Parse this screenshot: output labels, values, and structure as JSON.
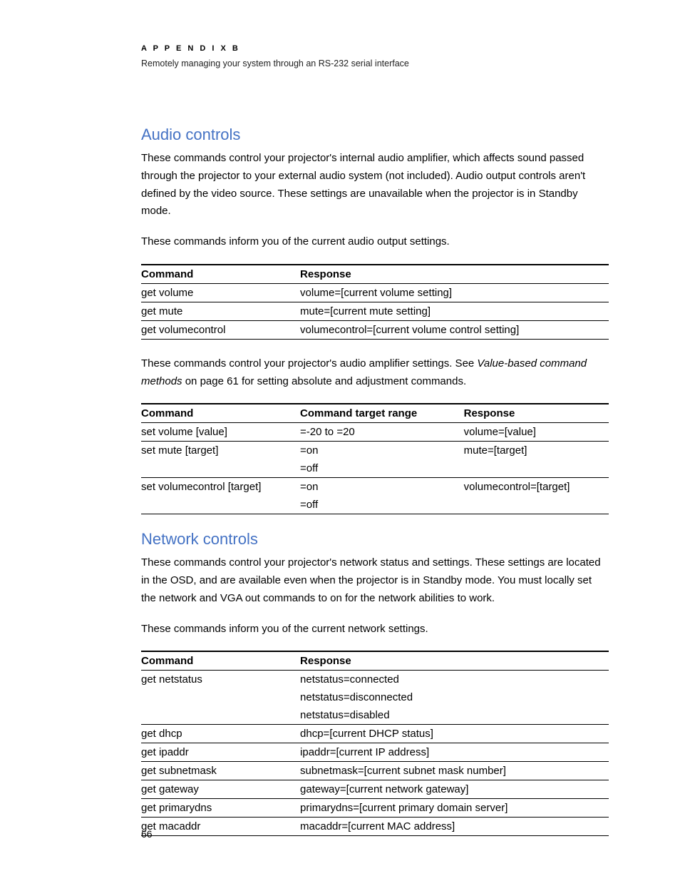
{
  "header": {
    "appendix": "A P P E N D I X   B",
    "subtitle": "Remotely managing your system through an RS-232 serial interface"
  },
  "section1": {
    "heading": "Audio controls",
    "para1": "These commands control your projector's internal audio amplifier, which affects sound passed through the projector to your external audio system (not included). Audio output controls aren't defined by the video source. These settings are unavailable when the projector is in Standby mode.",
    "para2": "These commands inform you of the current audio output settings.",
    "para3a": "These commands control your projector's audio amplifier settings. See ",
    "para3_italic": "Value-based command methods",
    "para3b": " on page 61 for setting absolute and adjustment commands."
  },
  "table1": {
    "h1": "Command",
    "h2": "Response",
    "rows": [
      {
        "c": "get volume",
        "r": "volume=[current volume setting]"
      },
      {
        "c": "get mute",
        "r": "mute=[current mute setting]"
      },
      {
        "c": "get volumecontrol",
        "r": "volumecontrol=[current volume control setting]"
      }
    ]
  },
  "table2": {
    "h1": "Command",
    "h2": "Command target range",
    "h3": "Response",
    "rows": [
      {
        "c": "set volume [value]",
        "t": "=-20 to =20",
        "r": "volume=[value]"
      },
      {
        "c": "set mute [target]",
        "t": "=on",
        "r": "mute=[target]"
      },
      {
        "c": "",
        "t": "=off",
        "r": ""
      },
      {
        "c": "set volumecontrol [target]",
        "t": "=on",
        "r": "volumecontrol=[target]"
      },
      {
        "c": "",
        "t": "=off",
        "r": ""
      }
    ]
  },
  "section2": {
    "heading": "Network controls",
    "para1": "These commands control your projector's network status and settings. These settings are located in the OSD, and are available even when the projector is in Standby mode. You must locally set the network and VGA out commands to on for the network abilities to work.",
    "para2": "These commands inform you of the current network settings."
  },
  "table3": {
    "h1": "Command",
    "h2": "Response",
    "rows": [
      {
        "c": "get netstatus",
        "r": "netstatus=connected"
      },
      {
        "c": "",
        "r": "netstatus=disconnected"
      },
      {
        "c": "",
        "r": "netstatus=disabled"
      },
      {
        "c": "get dhcp",
        "r": "dhcp=[current DHCP status]"
      },
      {
        "c": "get ipaddr",
        "r": "ipaddr=[current IP address]"
      },
      {
        "c": "get subnetmask",
        "r": "subnetmask=[current subnet mask number]"
      },
      {
        "c": "get gateway",
        "r": "gateway=[current network gateway]"
      },
      {
        "c": "get primarydns",
        "r": "primarydns=[current primary domain server]"
      },
      {
        "c": "get macaddr",
        "r": "macaddr=[current MAC address]"
      }
    ]
  },
  "pagenum": "66"
}
